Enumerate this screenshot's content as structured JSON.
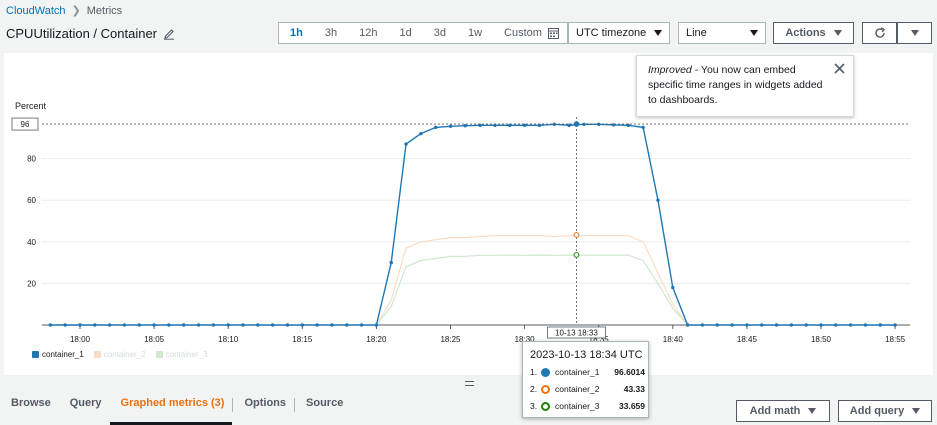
{
  "breadcrumb": {
    "root": "CloudWatch",
    "current": "Metrics"
  },
  "page_title": "CPUUtilization / Container",
  "time_ranges": [
    "1h",
    "3h",
    "12h",
    "1d",
    "3d",
    "1w"
  ],
  "active_range": "1h",
  "custom_label": "Custom",
  "timezone": {
    "value": "UTC timezone"
  },
  "chart_type_select": {
    "value": "Line"
  },
  "actions_label": "Actions",
  "toast": {
    "emphasis": "Improved",
    "message": " - You now can embed specific time ranges in widgets added to dashboards."
  },
  "chart_data": {
    "type": "line",
    "ylabel": "Percent",
    "y_ticks": [
      20,
      40,
      60,
      80
    ],
    "ylim": [
      0,
      100
    ],
    "x_ticks": [
      "18:00",
      "18:05",
      "18:10",
      "18:15",
      "18:20",
      "18:25",
      "18:30",
      "18:35",
      "18:40",
      "18:45",
      "18:50",
      "18:55"
    ],
    "crosshair_y_label": "96",
    "crosshair_x_label": "10-13 18:33",
    "crosshair_x_minutes": 33.5,
    "series": [
      {
        "name": "container_1",
        "color": "#1f77b4",
        "x": [
          -2,
          -1,
          0,
          1,
          2,
          3,
          4,
          5,
          6,
          7,
          8,
          9,
          10,
          11,
          12,
          13,
          14,
          15,
          16,
          17,
          18,
          19,
          20,
          21,
          22,
          23,
          24,
          25,
          26,
          27,
          28,
          29,
          30,
          31,
          32,
          33,
          34,
          35,
          36,
          37,
          38,
          39,
          40,
          41,
          42,
          43,
          44,
          45,
          46,
          47,
          48,
          49,
          50,
          51,
          52,
          53,
          54,
          55
        ],
        "values": [
          0,
          0,
          0,
          0,
          0,
          0,
          0,
          0,
          0,
          0,
          0,
          0,
          0,
          0,
          0,
          0,
          0,
          0,
          0,
          0,
          0,
          0,
          0,
          30,
          87,
          92,
          95,
          95.5,
          95.8,
          96,
          96,
          96,
          96,
          96,
          96.5,
          96,
          96.5,
          96.5,
          96.2,
          96,
          95,
          60,
          18,
          0,
          0,
          0,
          0,
          0,
          0,
          0,
          0,
          0,
          0,
          0,
          0,
          0,
          0,
          0
        ]
      },
      {
        "name": "container_2",
        "color": "#f8ddc6",
        "x": [
          -2,
          20,
          21,
          22,
          23,
          24,
          25,
          26,
          27,
          28,
          29,
          30,
          31,
          32,
          33,
          34,
          35,
          36,
          37,
          38,
          39,
          40,
          41,
          55
        ],
        "values": [
          0,
          0,
          12,
          37,
          40,
          41,
          42,
          42,
          42.5,
          43,
          43,
          43,
          43,
          42.5,
          43,
          43,
          43,
          43,
          43,
          40,
          25,
          10,
          0,
          0
        ]
      },
      {
        "name": "container_3",
        "color": "#cfe8cf",
        "x": [
          -2,
          20,
          21,
          22,
          23,
          24,
          25,
          26,
          27,
          28,
          29,
          30,
          31,
          32,
          33,
          34,
          35,
          36,
          37,
          38,
          39,
          40,
          41,
          55
        ],
        "values": [
          0,
          0,
          9,
          28,
          31,
          32,
          33,
          33,
          33.5,
          33.5,
          33.6,
          33.5,
          33.6,
          33.5,
          33.6,
          33.6,
          33.6,
          33.6,
          33.6,
          31,
          20,
          8,
          0,
          0
        ]
      }
    ]
  },
  "tooltip": {
    "title": "2023-10-13 18:34 UTC",
    "rows": [
      {
        "index": "1.",
        "name": "container_1",
        "value": "96.6014",
        "color": "#1f77b4"
      },
      {
        "index": "2.",
        "name": "container_2",
        "value": "43.33",
        "color": "#ec7211"
      },
      {
        "index": "3.",
        "name": "container_3",
        "value": "33.659",
        "color": "#1d8102"
      }
    ]
  },
  "tabs": [
    "Browse",
    "Query",
    "Graphed metrics (3)",
    "Options",
    "Source"
  ],
  "active_tab": "Graphed metrics (3)",
  "buttons": {
    "add_math": "Add math",
    "add_query": "Add query"
  }
}
